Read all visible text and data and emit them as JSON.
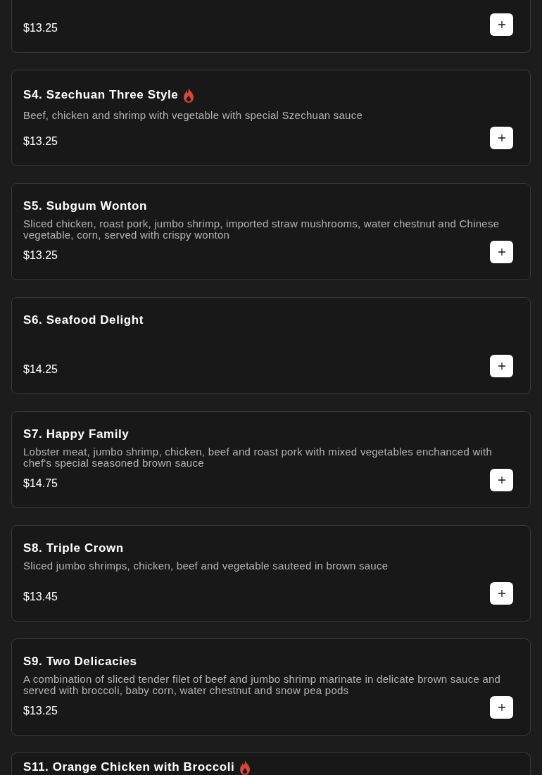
{
  "menu_items": [
    {
      "price": "$13.25"
    },
    {
      "name": "S4. Szechuan Three Style",
      "spicy": true,
      "description": "Beef, chicken and shrimp with vegetable with special Szechuan sauce",
      "price": "$13.25"
    },
    {
      "name": "S5. Subgum Wonton",
      "spicy": false,
      "description": "Sliced chicken, roast pork, jumbo shrimp, imported straw mushrooms, water chestnut and Chinese vegetable, corn, served with crispy wonton",
      "price": "$13.25"
    },
    {
      "name": "S6. Seafood Delight",
      "spicy": false,
      "price": "$14.25"
    },
    {
      "name": "S7. Happy Family",
      "spicy": false,
      "description": "Lobster meat, jumbo shrimp, chicken, beef and roast pork with mixed vegetables enchanced with chef's special seasoned brown sauce",
      "price": "$14.75"
    },
    {
      "name": "S8. Triple Crown",
      "spicy": false,
      "description": "Sliced jumbo shrimps, chicken, beef and vegetable sauteed in brown sauce",
      "price": "$13.45"
    },
    {
      "name": "S9. Two Delicacies",
      "spicy": false,
      "description": "A combination of sliced tender filet of beef and jumbo shrimp marinate in delicate brown sauce and served with broccoli, baby corn, water chestnut and snow pea pods",
      "price": "$13.25"
    },
    {
      "name": "S11. Orange Chicken with Broccoli",
      "spicy": true
    }
  ]
}
